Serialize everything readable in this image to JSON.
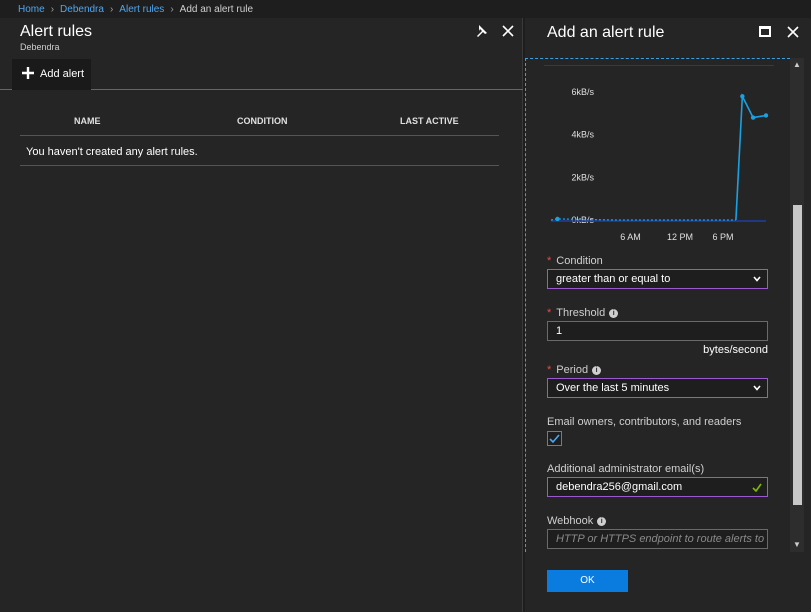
{
  "breadcrumb": {
    "items": [
      "Home",
      "Debendra",
      "Alert rules"
    ],
    "current": "Add an alert rule"
  },
  "left_blade": {
    "title": "Alert rules",
    "subtitle": "Debendra",
    "add_button": "Add alert",
    "table": {
      "columns": [
        "NAME",
        "CONDITION",
        "LAST ACTIVE"
      ],
      "empty_message": "You haven't created any alert rules."
    }
  },
  "right_blade": {
    "title": "Add an alert rule",
    "chart_data": {
      "type": "line",
      "y_tick_labels": [
        "6kB/s",
        "4kB/s",
        "2kB/s",
        "0kB/s"
      ],
      "x_tick_labels": [
        "6 AM",
        "12 PM",
        "6 PM"
      ],
      "ylim": [
        0,
        6
      ],
      "series": [
        {
          "x": [
            0,
            0.03,
            0.3,
            0.5,
            0.8,
            0.86,
            0.89,
            0.94,
            1.0
          ],
          "values": [
            0,
            0.05,
            0,
            0,
            0,
            0,
            5.8,
            4.8,
            4.9
          ]
        }
      ],
      "color": "#1ba1e2"
    },
    "condition": {
      "label": "Condition",
      "value": "greater than or equal to"
    },
    "threshold": {
      "label": "Threshold",
      "value": "1",
      "unit": "bytes/second"
    },
    "period": {
      "label": "Period",
      "value": "Over the last 5 minutes"
    },
    "email_owners": {
      "label": "Email owners, contributors, and readers",
      "checked": true
    },
    "admin_email": {
      "label": "Additional administrator email(s)",
      "value": "debendra256@gmail.com"
    },
    "webhook": {
      "label": "Webhook",
      "placeholder": "HTTP or HTTPS endpoint to route alerts to"
    },
    "ok_button": "OK"
  },
  "colors": {
    "accent": "#0a7ce0",
    "focus_border": "#9b59d0",
    "required": "#e84c3d",
    "link": "#4fa6ef"
  }
}
